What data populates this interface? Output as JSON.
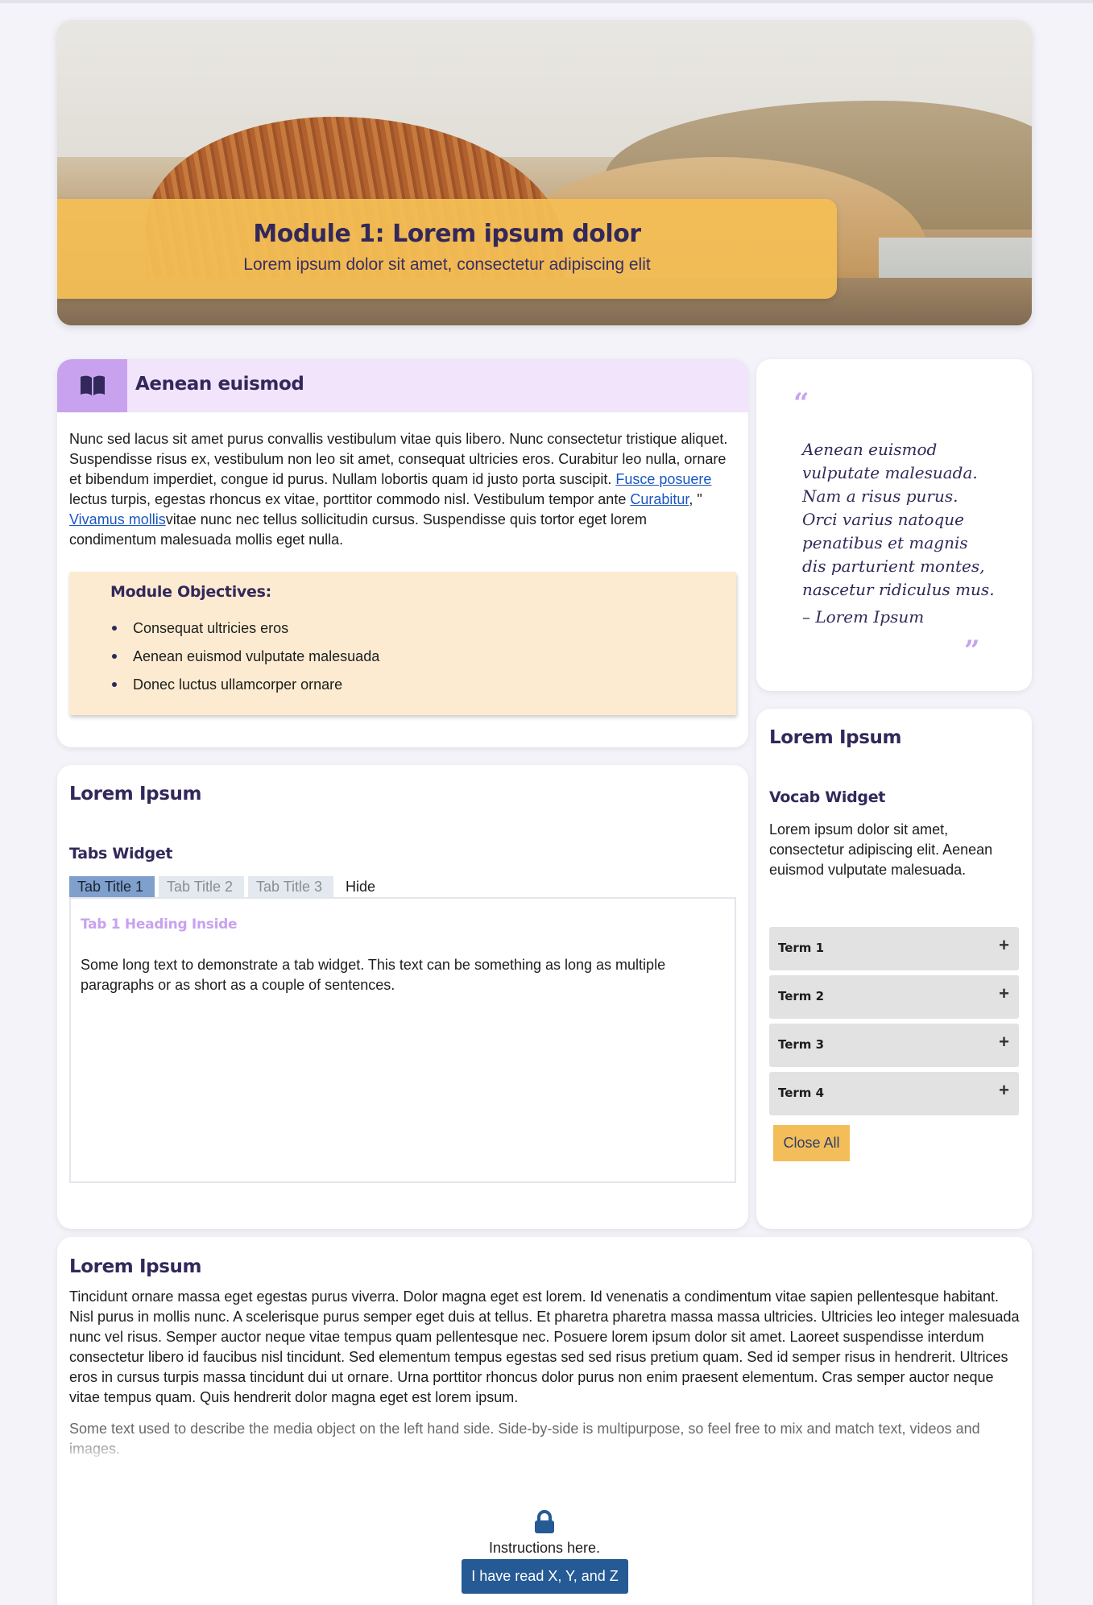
{
  "hero": {
    "title": "Module 1: Lorem ipsum dolor",
    "subtitle": "Lorem ipsum dolor sit amet, consectetur adipiscing elit"
  },
  "intro_card": {
    "title": "Aenean euismod",
    "icon": "book-icon",
    "paragraph": {
      "part1": "Nunc sed lacus sit amet purus convallis vestibulum vitae quis libero. Nunc consectetur tristique aliquet. Suspendisse risus ex, vestibulum non leo sit amet, consequat ultricies eros. Curabitur leo nulla, ornare et bibendum imperdiet, congue id purus. Nullam lobortis quam id justo porta suscipit. ",
      "link1": "Fusce posuere",
      "part2": " lectus turpis, egestas rhoncus ex vitae, porttitor commodo nisl. Vestibulum tempor ante ",
      "link2": "Curabitur",
      "part3": ", \" ",
      "link3": "Vivamus mollis",
      "part4": "vitae nunc nec tellus sollicitudin cursus. Suspendisse quis tortor eget lorem condimentum malesuada mollis eget nulla."
    },
    "objectives": {
      "title": "Module Objectives:",
      "items": [
        "Consequat ultricies eros",
        "Aenean euismod vulputate malesuada",
        "Donec luctus ullamcorper ornare"
      ]
    }
  },
  "quote": {
    "open_mark": "“",
    "text": "Aenean euismod vulputate malesuada. Nam a risus purus. Orci varius natoque penatibus et magnis dis parturient montes, nascetur ridiculus mus.",
    "cite": "– Lorem Ipsum",
    "close_mark": "”"
  },
  "tabs_card": {
    "heading": "Lorem Ipsum",
    "widget_title": "Tabs Widget",
    "tabs": [
      "Tab Title 1",
      "Tab Title 2",
      "Tab Title 3",
      "Hide"
    ],
    "active_tab": 0,
    "panel_heading": "Tab 1 Heading Inside",
    "panel_text": "Some long text to demonstrate a tab widget. This text can be something as long as multiple paragraphs or as short as a couple of sentences."
  },
  "vocab_card": {
    "heading": "Lorem Ipsum",
    "widget_title": "Vocab Widget",
    "description": "Lorem ipsum dolor sit amet, consectetur adipiscing elit. Aenean euismod vulputate malesuada.",
    "terms": [
      "Term 1",
      "Term 2",
      "Term 3",
      "Term 4"
    ],
    "expand_symbol": "+",
    "close_all_label": "Close All"
  },
  "bottom_card": {
    "heading": "Lorem Ipsum",
    "paragraph": "Tincidunt ornare massa eget egestas purus viverra. Dolor magna eget est lorem. Id venenatis a condimentum vitae sapien pellentesque habitant. Nisl purus in mollis nunc. A scelerisque purus semper eget duis at tellus. Et pharetra pharetra massa massa ultricies. Ultricies leo integer malesuada nunc vel risus. Semper auctor neque vitae tempus quam pellentesque nec. Posuere lorem ipsum dolor sit amet. Laoreet suspendisse interdum consectetur libero id faucibus nisl tincidunt. Sed elementum tempus egestas sed sed risus pretium quam. Sed id semper risus in hendrerit. Ultrices eros in cursus turpis massa tincidunt dui ut ornare. Urna porttitor rhoncus dolor purus non enim praesent elementum. Cras semper auctor neque vitae tempus quam. Quis hendrerit dolor magna eget est lorem ipsum.",
    "media_text": "Some text used to describe the media object on the left hand side. Side-by-side is multipurpose, so feel free to mix and match text, videos and images.",
    "lock_icon": "lock-icon",
    "instructions": "Instructions here.",
    "button_label": "I have read X, Y, and Z"
  },
  "colors": {
    "page_bg": "#f3f3f9",
    "banner": "#f4be55",
    "heading": "#33285a",
    "accent_purple": "#c8a2ef",
    "header_purple_bg": "#f1e4fb",
    "objectives_bg": "#fcebd1",
    "tab_active": "#7fa0cc",
    "button_blue": "#255a94",
    "close_all": "#f3bd5a"
  }
}
